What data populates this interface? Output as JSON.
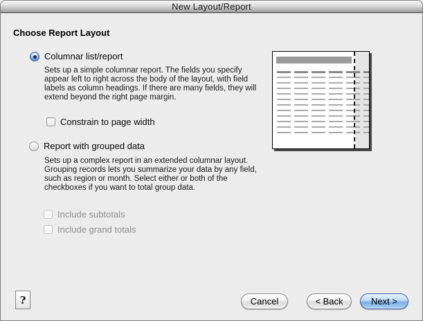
{
  "window": {
    "title": "New Layout/Report"
  },
  "heading": "Choose Report Layout",
  "options": {
    "columnar": {
      "label": "Columnar list/report",
      "selected": true,
      "description": "Sets up a simple columnar report. The fields you specify appear left to right across the body of the layout, with field labels as column headings. If there are many fields, they will extend beyond the right page margin.",
      "constrain_checkbox": {
        "label": "Constrain to page width",
        "checked": false
      }
    },
    "grouped": {
      "label": "Report with grouped data",
      "selected": false,
      "description": "Sets up a complex report in an extended columnar layout. Grouping records lets you summarize your data by any field, such as region or month. Select either or both of the checkboxes if you want to total group data.",
      "checkboxes": [
        {
          "label": "Include subtotals",
          "checked": false,
          "disabled": true
        },
        {
          "label": "Include grand totals",
          "checked": false,
          "disabled": true
        }
      ]
    }
  },
  "preview": {
    "kind": "columnar-report-page-thumbnail"
  },
  "footer": {
    "help_label": "?",
    "cancel_label": "Cancel",
    "back_label": "< Back",
    "next_label": "Next >"
  },
  "colors": {
    "dialog_background": "#ececec",
    "titlebar_gradient_bottom": "#989898",
    "disabled_text": "#8f8f8f",
    "primary_button_blue": "#7cade4",
    "preview_header_bar": "#9b9b9b",
    "preview_margin_strip": "#e4e4e4"
  }
}
